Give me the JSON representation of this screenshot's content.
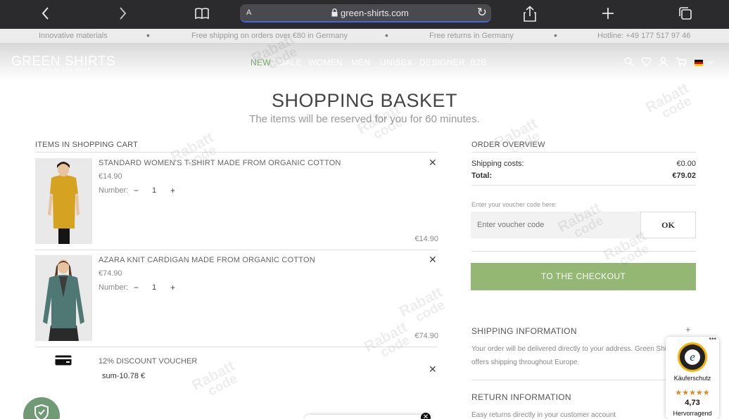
{
  "browser": {
    "address_letter": "A",
    "url": "green-shirts.com"
  },
  "info_strip": [
    "Innovative materials",
    "Free shipping on orders over €80 in Germany",
    "Free returns in Germany",
    "Hotline: +49 177 517 97 46"
  ],
  "header": {
    "logo": "GREEN SHIRTS",
    "logo_tagline": "SOCIAL ECO WEAR",
    "nav": [
      "NEW",
      "SALE",
      "WOMEN",
      "MEN",
      "UNISEX",
      "DESIGNER",
      "B2B"
    ],
    "active_nav": "NEW",
    "accent_color": "#7aa86a"
  },
  "page": {
    "title": "SHOPPING BASKET",
    "subtitle": "The items will be reserved for you for 60 minutes."
  },
  "cart": {
    "heading": "ITEMS IN SHOPPING CART",
    "number_label": "Number:",
    "items": [
      {
        "name": "STANDARD WOMEN'S T-SHIRT MADE FROM ORGANIC COTTON",
        "price": "€14.90",
        "quantity": "1",
        "total": "€14.90",
        "image": "woman-mustard-tshirt"
      },
      {
        "name": "AZARA KNIT CARDIGAN MADE FROM ORGANIC COTTON",
        "price": "€74.90",
        "quantity": "1",
        "total": "€74.90",
        "image": "woman-teal-cardigan"
      }
    ],
    "voucher": {
      "name": "12% DISCOUNT VOUCHER",
      "sum": "sum-10.78 €",
      "icon": "credit-card-icon"
    }
  },
  "overview": {
    "heading": "ORDER OVERVIEW",
    "shipping_label": "Shipping costs:",
    "shipping_value": "€0.00",
    "total_label": "Total:",
    "total_value": "€79.02",
    "voucher_label": "Enter your voucher code here:",
    "voucher_placeholder": "Enter voucher code",
    "ok_label": "OK",
    "checkout_label": "TO THE CHECKOUT",
    "checkout_color": "#94b874",
    "shipping_info_heading": "SHIPPING INFORMATION",
    "shipping_info_lines": [
      "Your order will be delivered directly to your address. Green Shirts",
      "offers shipping throughout Europe."
    ],
    "return_info_heading": "RETURN INFORMATION",
    "return_info_lines": [
      "Easy returns directly in your customer account"
    ]
  },
  "trust_badge": {
    "seal_letter": "e",
    "label": "Käuferschutz",
    "stars": "★★★★★",
    "rating": "4,73",
    "verdict": "Hervorragend"
  },
  "watermark": {
    "line1": "Rabatt",
    "line2": "code"
  }
}
